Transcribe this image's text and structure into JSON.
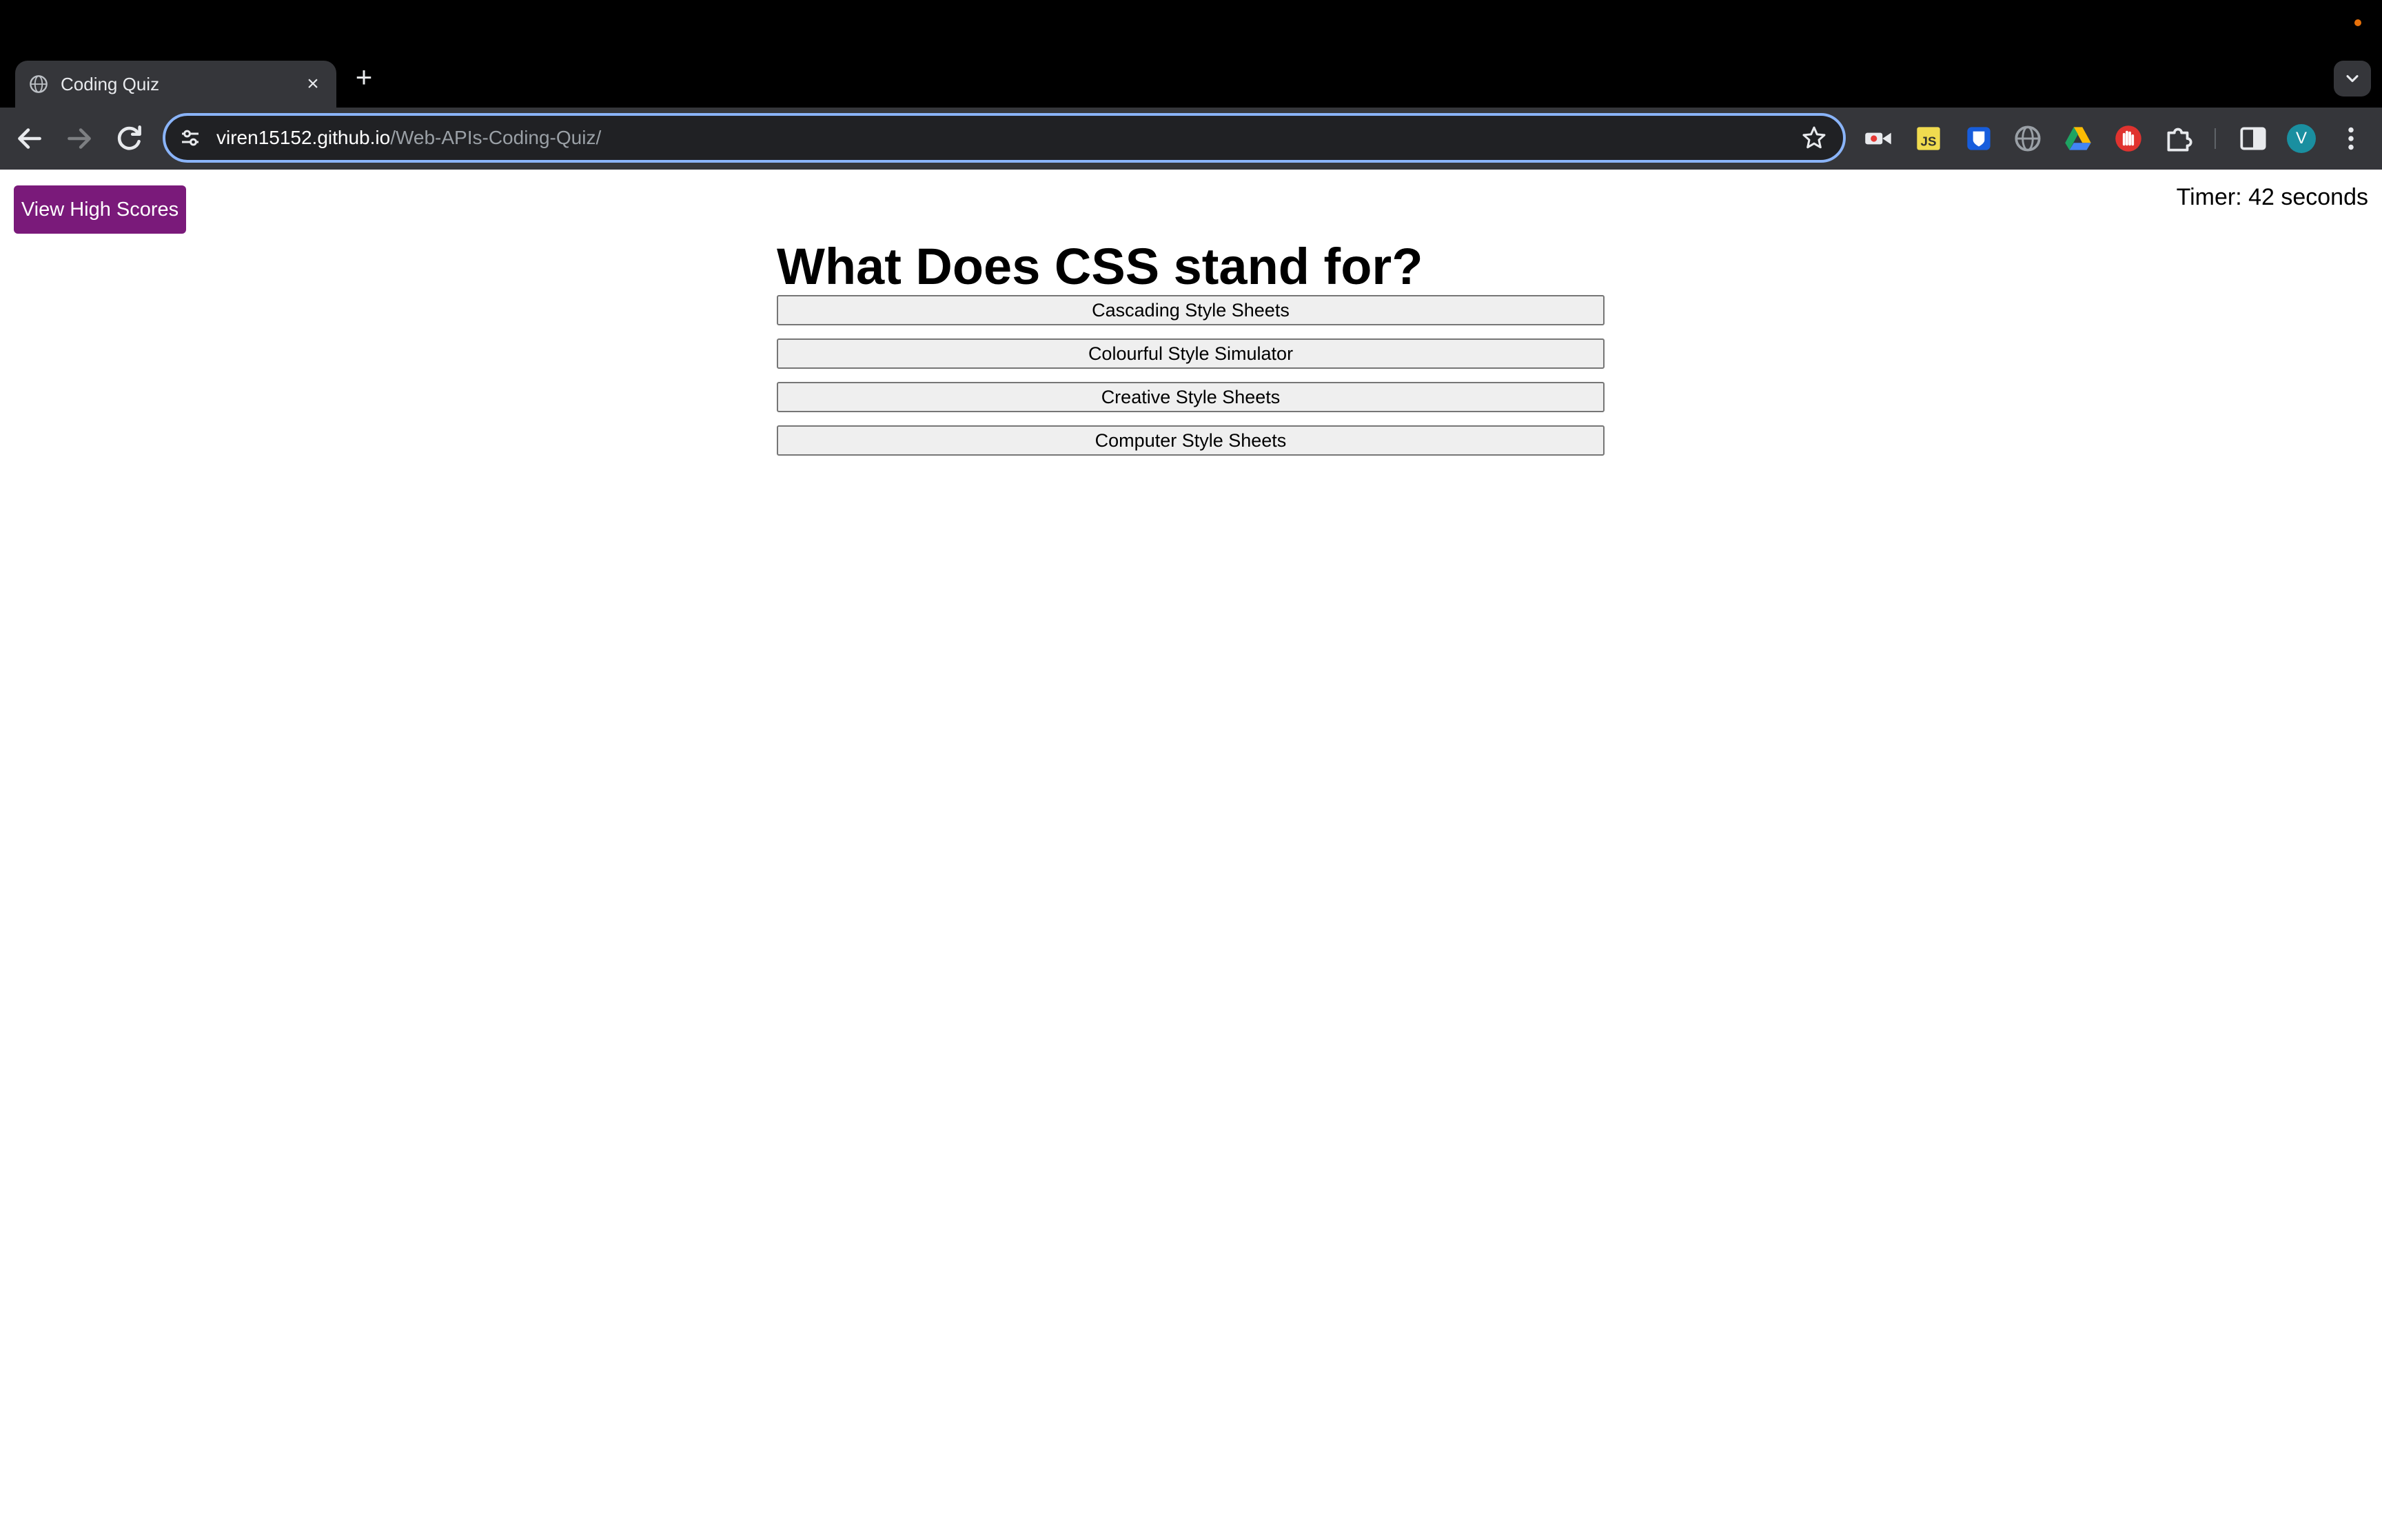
{
  "browser": {
    "tab": {
      "title": "Coding Quiz",
      "close_glyph": "×",
      "favicon": "globe-icon"
    },
    "new_tab_glyph": "+",
    "address_bar": {
      "host": "viren15152.github.io",
      "path": "/Web-APIs-Coding-Quiz/"
    },
    "profile_initial": "V",
    "extensions": [
      "screen-recorder-icon",
      "js-icon",
      "bitwarden-icon",
      "globe-icon",
      "google-drive-icon",
      "red-hand-icon",
      "puzzle-piece-icon"
    ],
    "colors": {
      "frame": "#000000",
      "toolbar": "#35363a",
      "omnibox_focus": "#8ab4f8"
    }
  },
  "page": {
    "high_scores_label": "View High Scores",
    "timer_text": "Timer: 42 seconds",
    "question": "What Does CSS stand for?",
    "answers": [
      "Cascading Style Sheets",
      "Colourful Style Simulator",
      "Creative Style Sheets",
      "Computer Style Sheets"
    ],
    "colors": {
      "accent": "#7a1a7a"
    }
  }
}
